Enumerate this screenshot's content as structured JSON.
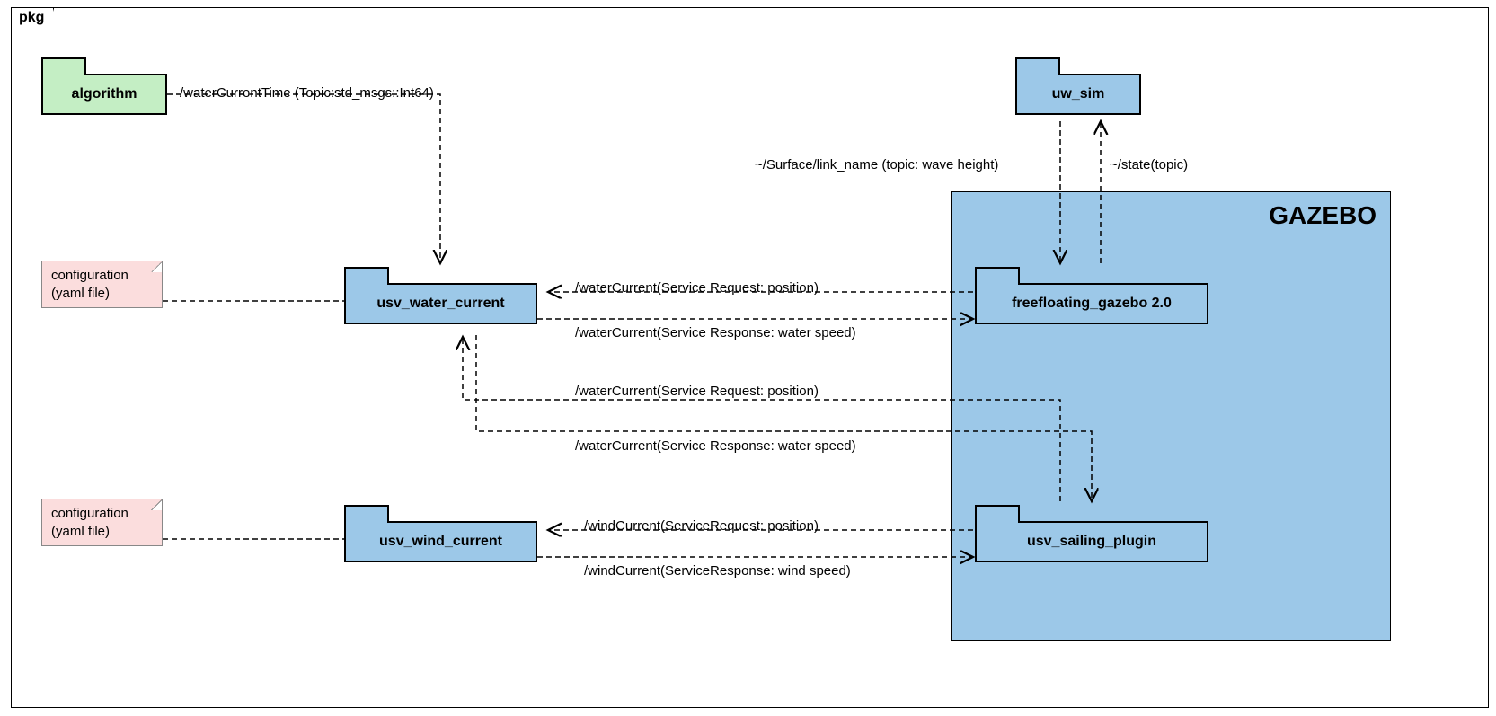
{
  "frame": {
    "title": "pkg"
  },
  "gazebo": {
    "title": "GAZEBO"
  },
  "packages": {
    "algorithm": "algorithm",
    "usv_water_current": "usv_water_current",
    "usv_wind_current": "usv_wind_current",
    "uw_sim": "uw_sim",
    "freefloating": "freefloating_gazebo 2.0",
    "usv_sailing_plugin": "usv_sailing_plugin"
  },
  "notes": {
    "config1": "configuration\n(yaml file)",
    "config2": "configuration\n(yaml file)"
  },
  "labels": {
    "waterCurrentTime": "/waterCurrentTime (Topic:std_msgs::Int64)",
    "surface": "~/Surface/link_name (topic: wave height)",
    "state": "~/state(topic)",
    "waterReq1": "/waterCurrent(Service Request: position)",
    "waterResp1": "/waterCurrent(Service Response: water speed)",
    "waterReq2": "/waterCurrent(Service Request: position)",
    "waterResp2": "/waterCurrent(Service Response: water speed)",
    "windReq": "/windCurrent(ServiceRequest: position)",
    "windResp": "/windCurrent(ServiceResponse: wind speed)"
  }
}
